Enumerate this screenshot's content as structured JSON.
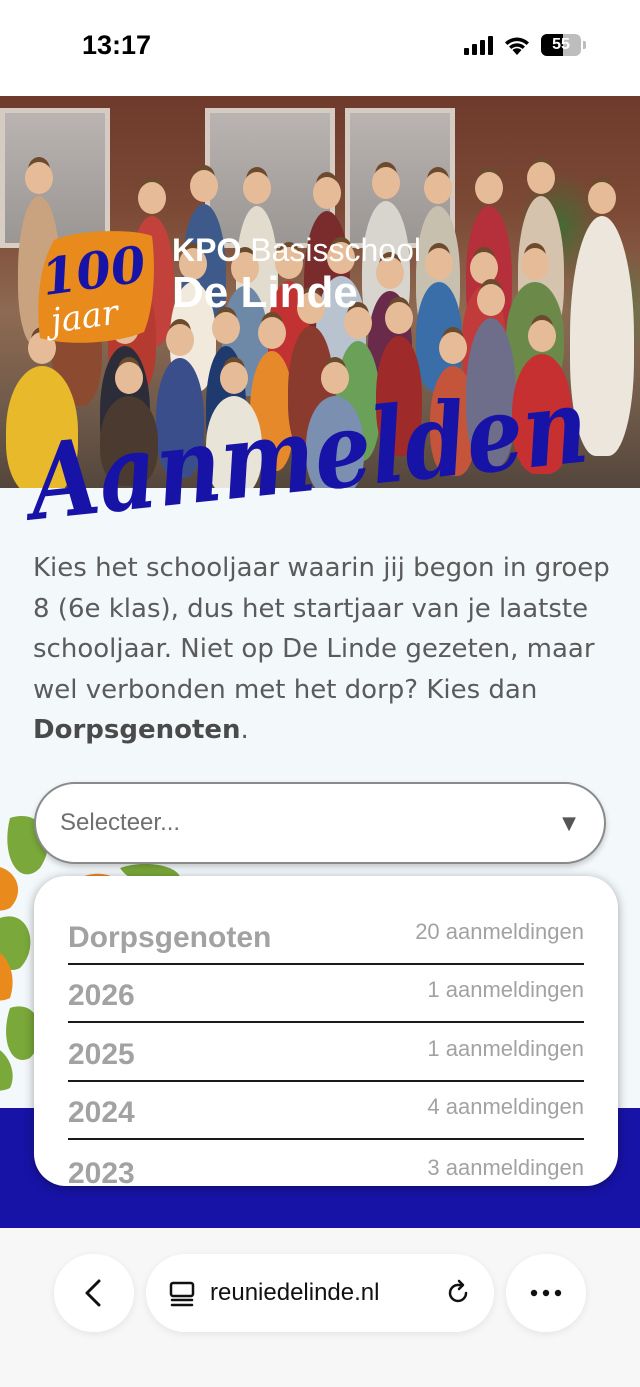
{
  "status_bar": {
    "time": "13:17",
    "battery": "55",
    "icons": [
      "signal-icon",
      "wifi-icon",
      "battery-icon"
    ]
  },
  "header": {
    "badge_number": "100",
    "badge_word": "jaar",
    "org_prefix": "KPO",
    "org_suffix": "Basisschool",
    "school_name": "De Linde",
    "page_title": "Aanmelden",
    "colors": {
      "badge_orange": "#e98a1c",
      "title_blue": "#1713a6"
    }
  },
  "intro": {
    "text_before": "Kies het schooljaar waarin jij begon in groep 8 (6e klas), dus het startjaar van je laatste schooljaar. Niet op De Linde gezeten, maar wel verbonden met het dorp? Kies dan ",
    "bold": "Dorpsgenoten",
    "text_after": "."
  },
  "select": {
    "placeholder": "Selecteer...",
    "caret": "▼"
  },
  "options": [
    {
      "label": "Dorpsgenoten",
      "count": "20 aanmeldingen"
    },
    {
      "label": "2026",
      "count": "1 aanmeldingen"
    },
    {
      "label": "2025",
      "count": "1 aanmeldingen"
    },
    {
      "label": "2024",
      "count": "4 aanmeldingen"
    },
    {
      "label": "2023",
      "count": "3 aanmeldingen"
    }
  ],
  "browser": {
    "url": "reuniedelinde.nl",
    "icons": [
      "back-icon",
      "tabs-icon",
      "reload-icon",
      "more-icon"
    ]
  }
}
